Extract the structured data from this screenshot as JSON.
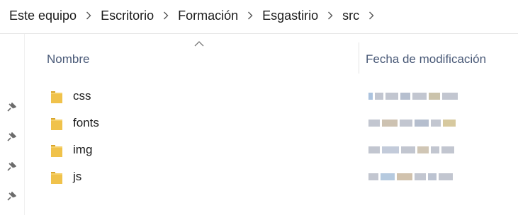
{
  "breadcrumb": {
    "items": [
      "Este equipo",
      "Escritorio",
      "Formación",
      "Esgastirio",
      "src"
    ]
  },
  "columns": {
    "name": "Nombre",
    "date": "Fecha de modificación"
  },
  "rows": [
    {
      "name": "css",
      "icon": "folder-icon"
    },
    {
      "name": "fonts",
      "icon": "folder-icon"
    },
    {
      "name": "img",
      "icon": "folder-icon"
    },
    {
      "name": "js",
      "icon": "folder-icon"
    }
  ],
  "colors": {
    "folder": "#f0c24b",
    "folder_dark": "#d9a62d",
    "header_text": "#4a5a78",
    "pin": "#6b6b6b"
  },
  "left_pane": {
    "pinned_icons": [
      "pin-icon",
      "pin-icon",
      "pin-icon",
      "pin-icon"
    ]
  }
}
